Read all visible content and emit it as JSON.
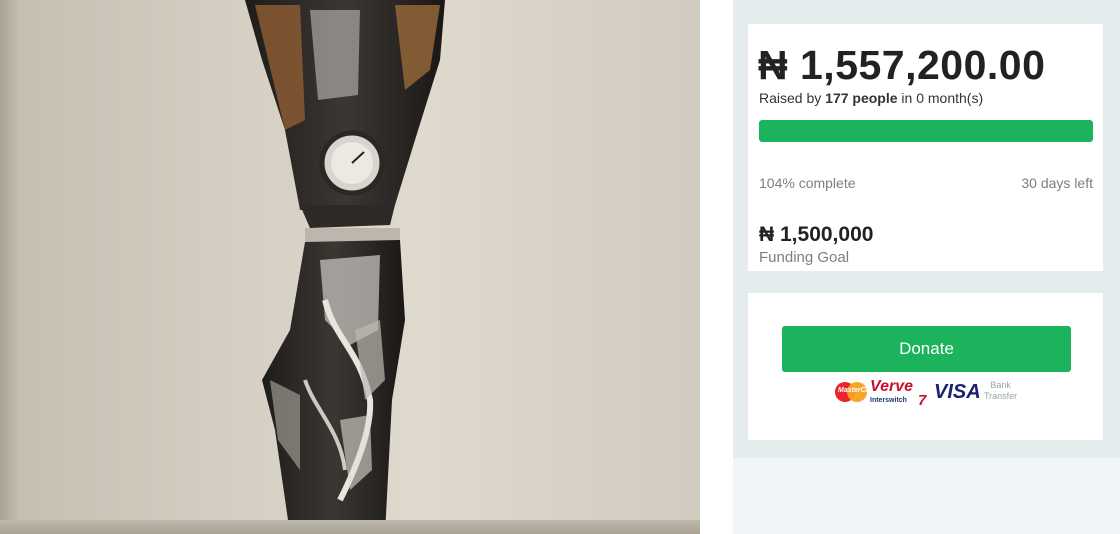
{
  "campaign": {
    "amount_raised": "₦ 1,557,200.00",
    "raised_prefix": "Raised by ",
    "raised_people": "177 people",
    "raised_suffix": " in 0 month(s)",
    "progress_fraction": 1.0,
    "percent_complete": "104% complete",
    "days_left": "30 days left",
    "goal_amount": "₦ 1,500,000",
    "goal_label": "Funding Goal"
  },
  "donate": {
    "button_label": "Donate",
    "payments": {
      "mastercard_text": "MasterCard",
      "verve_text": "Verve",
      "interswitch_text": "Interswitch",
      "interswitch_mark": "7",
      "visa_text": "VISA",
      "bank_line1": "Bank",
      "bank_line2": "Transfer"
    }
  },
  "colors": {
    "accent": "#1bb35c",
    "sidebar_bg": "#e4ecee",
    "text_dark": "#222222",
    "text_muted": "#7a7f84"
  }
}
